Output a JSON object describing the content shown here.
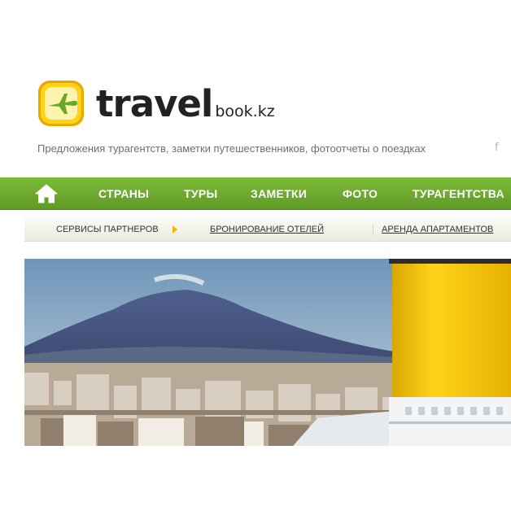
{
  "logo": {
    "main": "travel",
    "sub": "book.kz",
    "icon": "airplane-icon",
    "colors": {
      "badge": "#f6c400",
      "plane": "#6aa82c"
    }
  },
  "tagline": "Предложения турагентств, заметки путешественников, фотоотчеты о поездках",
  "social": {
    "facebook": "f"
  },
  "nav": {
    "home_icon": "home-icon",
    "items": [
      "СТРАНЫ",
      "ТУРЫ",
      "ЗАМЕТКИ",
      "ФОТО",
      "ТУРАГЕНТСТВА"
    ],
    "color": "#6aa82c"
  },
  "subnav": {
    "label": "СЕРВИСЫ ПАРТНЕРОВ",
    "links": [
      "БРОНИРОВАНИЕ ОТЕЛЕЙ",
      "АРЕНДА АПАРТАМЕНТОВ"
    ],
    "arrow_color": "#f2b800"
  }
}
